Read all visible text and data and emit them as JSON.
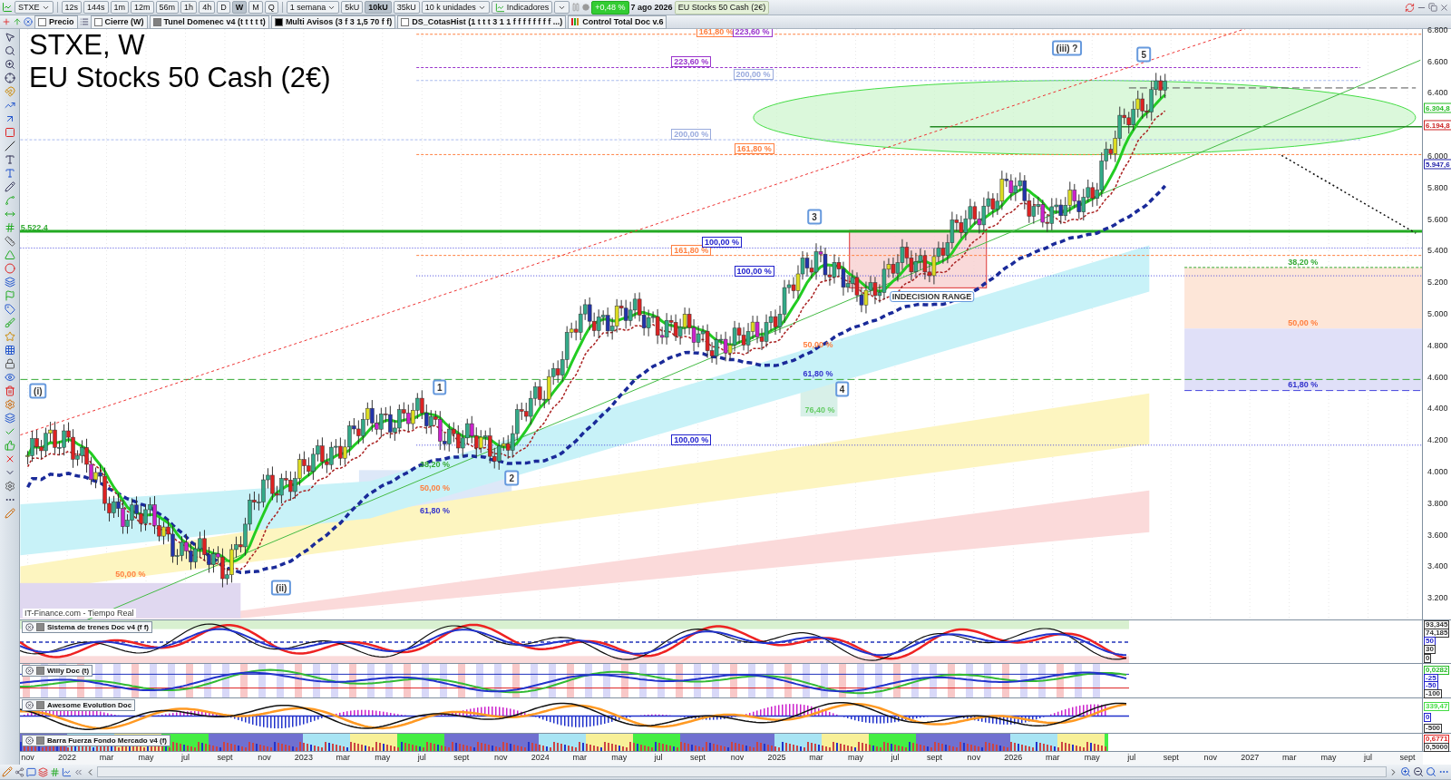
{
  "toolbar": {
    "symbol": "STXE",
    "timeframes": [
      {
        "label": "12s",
        "selected": false
      },
      {
        "label": "144s",
        "selected": false
      },
      {
        "label": "1m",
        "selected": false
      },
      {
        "label": "12m",
        "selected": false
      },
      {
        "label": "56m",
        "selected": false
      },
      {
        "label": "1h",
        "selected": false
      },
      {
        "label": "4h",
        "selected": false
      },
      {
        "label": "D",
        "selected": false
      },
      {
        "label": "W",
        "selected": true
      },
      {
        "label": "M",
        "selected": false
      },
      {
        "label": "Q",
        "selected": false
      }
    ],
    "period": "1 semana",
    "unit_buttons": [
      {
        "label": "5kU",
        "selected": false
      },
      {
        "label": "10kU",
        "selected": true
      },
      {
        "label": "35kU",
        "selected": false
      }
    ],
    "units": "10 k unidades",
    "indicators": "Indicadores",
    "change": "+0,48 %",
    "date": "7 ago 2026",
    "instrument": "EU Stocks 50 Cash (2€)"
  },
  "legend": [
    {
      "label": "Precio",
      "kind": "checkbox",
      "checked": false
    },
    {
      "label": "Cierre (W)",
      "kind": "checkbox",
      "checked": false
    },
    {
      "label": "Tunel Domenec v4 (t t t t t)",
      "kind": "swatch",
      "color": "#808080"
    },
    {
      "label": "Multi Avisos (3 f 3 1,5 70 f f)",
      "kind": "swatch",
      "color": "#000000"
    },
    {
      "label": "DS_CotasHist (1 t t t 3 1 1 f f f f f f f f ...)",
      "kind": "checkbox",
      "checked": false
    },
    {
      "label": "Control Total Doc v.6",
      "kind": "palette"
    }
  ],
  "chart": {
    "title": "STXE, W",
    "subtitle": "EU Stocks 50 Cash (2€)",
    "source": "IT-Finance.com - Tiempo Real",
    "annotations": [
      {
        "text": "161,80 %",
        "kind": "fib",
        "color": "#ff8040"
      },
      {
        "text": "223,60 %",
        "kind": "fib",
        "color": "#9933cc"
      },
      {
        "text": "(iii) ?",
        "kind": "wave",
        "color": "#6699dd"
      },
      {
        "text": "5",
        "kind": "wave",
        "color": "#6699dd"
      },
      {
        "text": "223,60 %",
        "kind": "fib",
        "color": "#9933cc"
      },
      {
        "text": "200,00 %",
        "kind": "fib",
        "color": "#99aadd"
      },
      {
        "text": "200,00 %",
        "kind": "fib",
        "color": "#99aadd"
      },
      {
        "text": "161,80 %",
        "kind": "fib",
        "color": "#ff8040"
      },
      {
        "text": "3",
        "kind": "wave",
        "color": "#6699dd"
      },
      {
        "text": "5.522,4",
        "kind": "plain",
        "color": "#33aa33"
      },
      {
        "text": "161,80 %",
        "kind": "fib",
        "color": "#ff8040"
      },
      {
        "text": "100,00 %",
        "kind": "fib",
        "color": "#2020cc"
      },
      {
        "text": "38,20 %",
        "kind": "plain",
        "color": "#33aa33"
      },
      {
        "text": "100,00 %",
        "kind": "fib",
        "color": "#2020cc"
      },
      {
        "text": "INDECISION RANGE",
        "kind": "note",
        "color": "#6699dd"
      },
      {
        "text": "50,00 %",
        "kind": "plain",
        "color": "#ff8040"
      },
      {
        "text": "50,00 %",
        "kind": "plain",
        "color": "#ff8040"
      },
      {
        "text": "61,80 %",
        "kind": "plain",
        "color": "#3333cc"
      },
      {
        "text": "(i)",
        "kind": "wave",
        "color": "#6699dd"
      },
      {
        "text": "1",
        "kind": "wave",
        "color": "#6699dd"
      },
      {
        "text": "4",
        "kind": "wave",
        "color": "#6699dd"
      },
      {
        "text": "61,80 %",
        "kind": "plain",
        "color": "#3333cc"
      },
      {
        "text": "76,40 %",
        "kind": "plain",
        "color": "#66cc66"
      },
      {
        "text": "100,00 %",
        "kind": "fib",
        "color": "#2020cc"
      },
      {
        "text": "38,20 %",
        "kind": "plain",
        "color": "#33aa33"
      },
      {
        "text": "2",
        "kind": "wave",
        "color": "#6699dd"
      },
      {
        "text": "50,00 %",
        "kind": "plain",
        "color": "#ff8040"
      },
      {
        "text": "61,80 %",
        "kind": "plain",
        "color": "#3333cc"
      },
      {
        "text": "50,00 %",
        "kind": "plain",
        "color": "#ff8040"
      },
      {
        "text": "(ii)",
        "kind": "wave",
        "color": "#6699dd"
      }
    ],
    "price_markers": [
      {
        "text": "6.304,8",
        "color": "#22bb22"
      },
      {
        "text": "6.194,8",
        "color": "#cc2222"
      },
      {
        "text": "5.947,6",
        "color": "#2222aa"
      }
    ],
    "price_axis": [
      "6.800",
      "6.600",
      "6.400",
      "6.000",
      "5.800",
      "5.600",
      "5.400",
      "5.200",
      "5.000",
      "4.800",
      "4.600",
      "4.400",
      "4.200",
      "4.000",
      "3.800",
      "3.600",
      "3.400",
      "3.200"
    ],
    "time_axis": [
      "nov",
      "2022",
      "mar",
      "may",
      "jul",
      "sept",
      "nov",
      "2023",
      "mar",
      "may",
      "jul",
      "sept",
      "nov",
      "2024",
      "mar",
      "may",
      "jul",
      "sept",
      "nov",
      "2025",
      "mar",
      "may",
      "jul",
      "sept",
      "nov",
      "2026",
      "mar",
      "may",
      "jul",
      "sept",
      "nov",
      "2027",
      "mar",
      "may",
      "jul",
      "sept"
    ]
  },
  "panels": [
    {
      "title": "Sistema de trenes Doc v4 (f f)",
      "kind": "trains",
      "axis": [
        {
          "text": "93,345",
          "color": "#333333"
        },
        {
          "text": "74,185",
          "color": "#333333"
        },
        {
          "text": "50",
          "color": "#2222cc"
        },
        {
          "text": "30",
          "color": "#333333"
        },
        {
          "text": "0",
          "color": "#333333"
        }
      ]
    },
    {
      "title": "Willy Doc (t)",
      "kind": "willy",
      "axis": [
        {
          "text": "0,0282",
          "color": "#22bb22"
        },
        {
          "text": "-25",
          "color": "#2222cc"
        },
        {
          "text": "-50",
          "color": "#2222cc"
        },
        {
          "text": "-100",
          "color": "#333333"
        }
      ]
    },
    {
      "title": "Awesome Evolution Doc",
      "kind": "awesome",
      "axis": [
        {
          "text": "339,47",
          "color": "#44dd44"
        },
        {
          "text": "0",
          "color": "#2222cc"
        },
        {
          "text": "-500",
          "color": "#333333"
        }
      ]
    },
    {
      "title": "Barra Fuerza Fondo Mercado v4 (f)",
      "kind": "barra",
      "axis": [
        {
          "text": "0,6771",
          "color": "#dd2222"
        },
        {
          "text": "0,5000",
          "color": "#333333"
        }
      ]
    }
  ]
}
